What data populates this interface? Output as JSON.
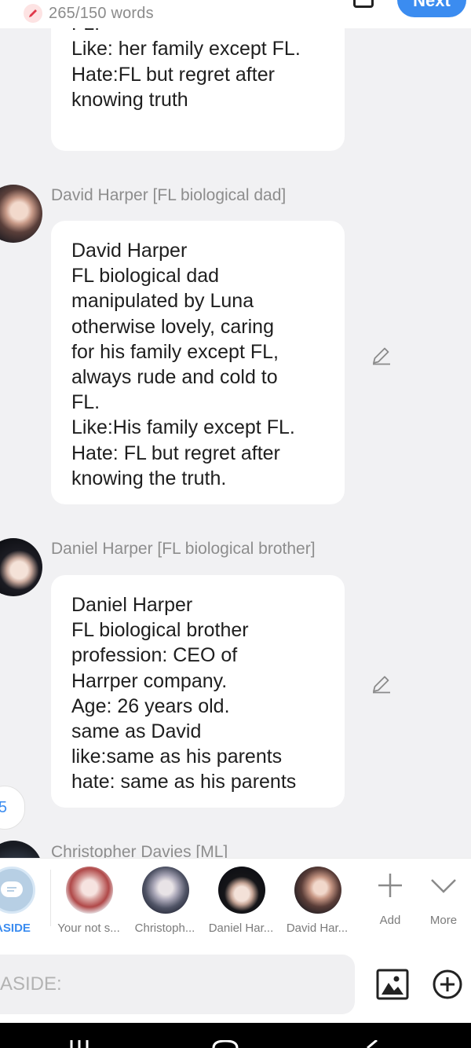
{
  "header": {
    "word_count": "265/150 words",
    "next_label": "Next"
  },
  "messages": [
    {
      "text": "FL, give cold shoulder to\nFL.\nLike: her family except FL.\nHate:FL but regret after\nknowing truth"
    },
    {
      "name": "David Harper [FL biological dad]",
      "text": "David Harper\nFL biological dad\nmanipulated by Luna\notherwise lovely, caring\nfor his family except FL,\nalways rude and cold to\nFL.\nLike:His family except FL.\nHate: FL but regret after\nknowing the truth."
    },
    {
      "name": "Daniel Harper [FL biological brother]",
      "text": "Daniel Harper\nFL biological brother\nprofession: CEO of\nHarrper company.\nAge: 26 years old.\nsame as David\nlike:same as his parents\nhate: same as his parents"
    },
    {
      "name": "Christopher Davies [ML]"
    }
  ],
  "float_badge": "5",
  "charbar": {
    "aside_label": "ASIDE",
    "characters": [
      {
        "label": "Your not s..."
      },
      {
        "label": "Christoph..."
      },
      {
        "label": "Daniel Har..."
      },
      {
        "label": "David Har..."
      }
    ],
    "add_label": "Add",
    "more_label": "More"
  },
  "input": {
    "placeholder": "ASIDE:"
  },
  "colors": {
    "accent": "#3b8cf0",
    "background": "#f1f1f3",
    "bubble": "#ffffff"
  }
}
